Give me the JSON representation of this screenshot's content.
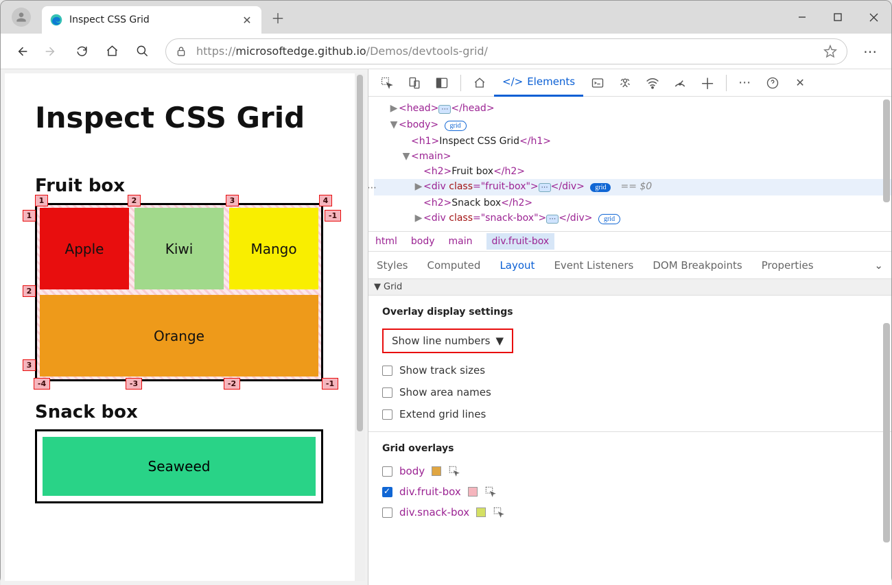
{
  "browser": {
    "tab_title": "Inspect CSS Grid",
    "url_prefix": "https://",
    "url_host": "microsoftedge.github.io",
    "url_path": "/Demos/devtools-grid/"
  },
  "page": {
    "h1": "Inspect CSS Grid",
    "h2_fruit": "Fruit box",
    "h2_snack": "Snack box",
    "cells": {
      "apple": "Apple",
      "kiwi": "Kiwi",
      "mango": "Mango",
      "orange": "Orange",
      "seaweed": "Seaweed"
    },
    "grid_lines_top": [
      "1",
      "2",
      "3",
      "4"
    ],
    "grid_lines_left": [
      "1",
      "2",
      "3"
    ],
    "grid_lines_right": [
      "-1"
    ],
    "grid_lines_bottom": [
      "-4",
      "-3",
      "-2",
      "-1"
    ]
  },
  "devtools": {
    "tabs": {
      "elements": "Elements"
    },
    "dom": {
      "head_open": "<head>",
      "head_close": "</head>",
      "body_open": "<body>",
      "h1_open": "<h1>",
      "h1_text": "Inspect CSS Grid",
      "h1_close": "</h1>",
      "main_open": "<main>",
      "h2f_open": "<h2>",
      "h2f_text": "Fruit box",
      "h2f_close": "</h2>",
      "divf_open": "<div ",
      "divf_class_k": "class",
      "divf_class_v": "=\"fruit-box\">",
      "divf_close": "</div>",
      "h2s_open": "<h2>",
      "h2s_text": "Snack box",
      "h2s_close": "</h2>",
      "divs_open": "<div ",
      "divs_class_v": "=\"snack-box\">",
      "divs_close": "</div>",
      "grid_badge": "grid",
      "eq0": "== $0"
    },
    "crumbs": [
      "html",
      "body",
      "main",
      "div.fruit-box"
    ],
    "subtabs": [
      "Styles",
      "Computed",
      "Layout",
      "Event Listeners",
      "DOM Breakpoints",
      "Properties"
    ],
    "grid_section": "Grid",
    "overlay_settings_title": "Overlay display settings",
    "line_dropdown": "Show line numbers",
    "cb_track": "Show track sizes",
    "cb_area": "Show area names",
    "cb_extend": "Extend grid lines",
    "overlays_title": "Grid overlays",
    "overlays": {
      "body": "body",
      "fruit": "div.fruit-box",
      "snack": "div.snack-box"
    },
    "colors": {
      "body": "#e0a642",
      "fruit": "#f5b5bd",
      "snack": "#d4e063"
    }
  }
}
